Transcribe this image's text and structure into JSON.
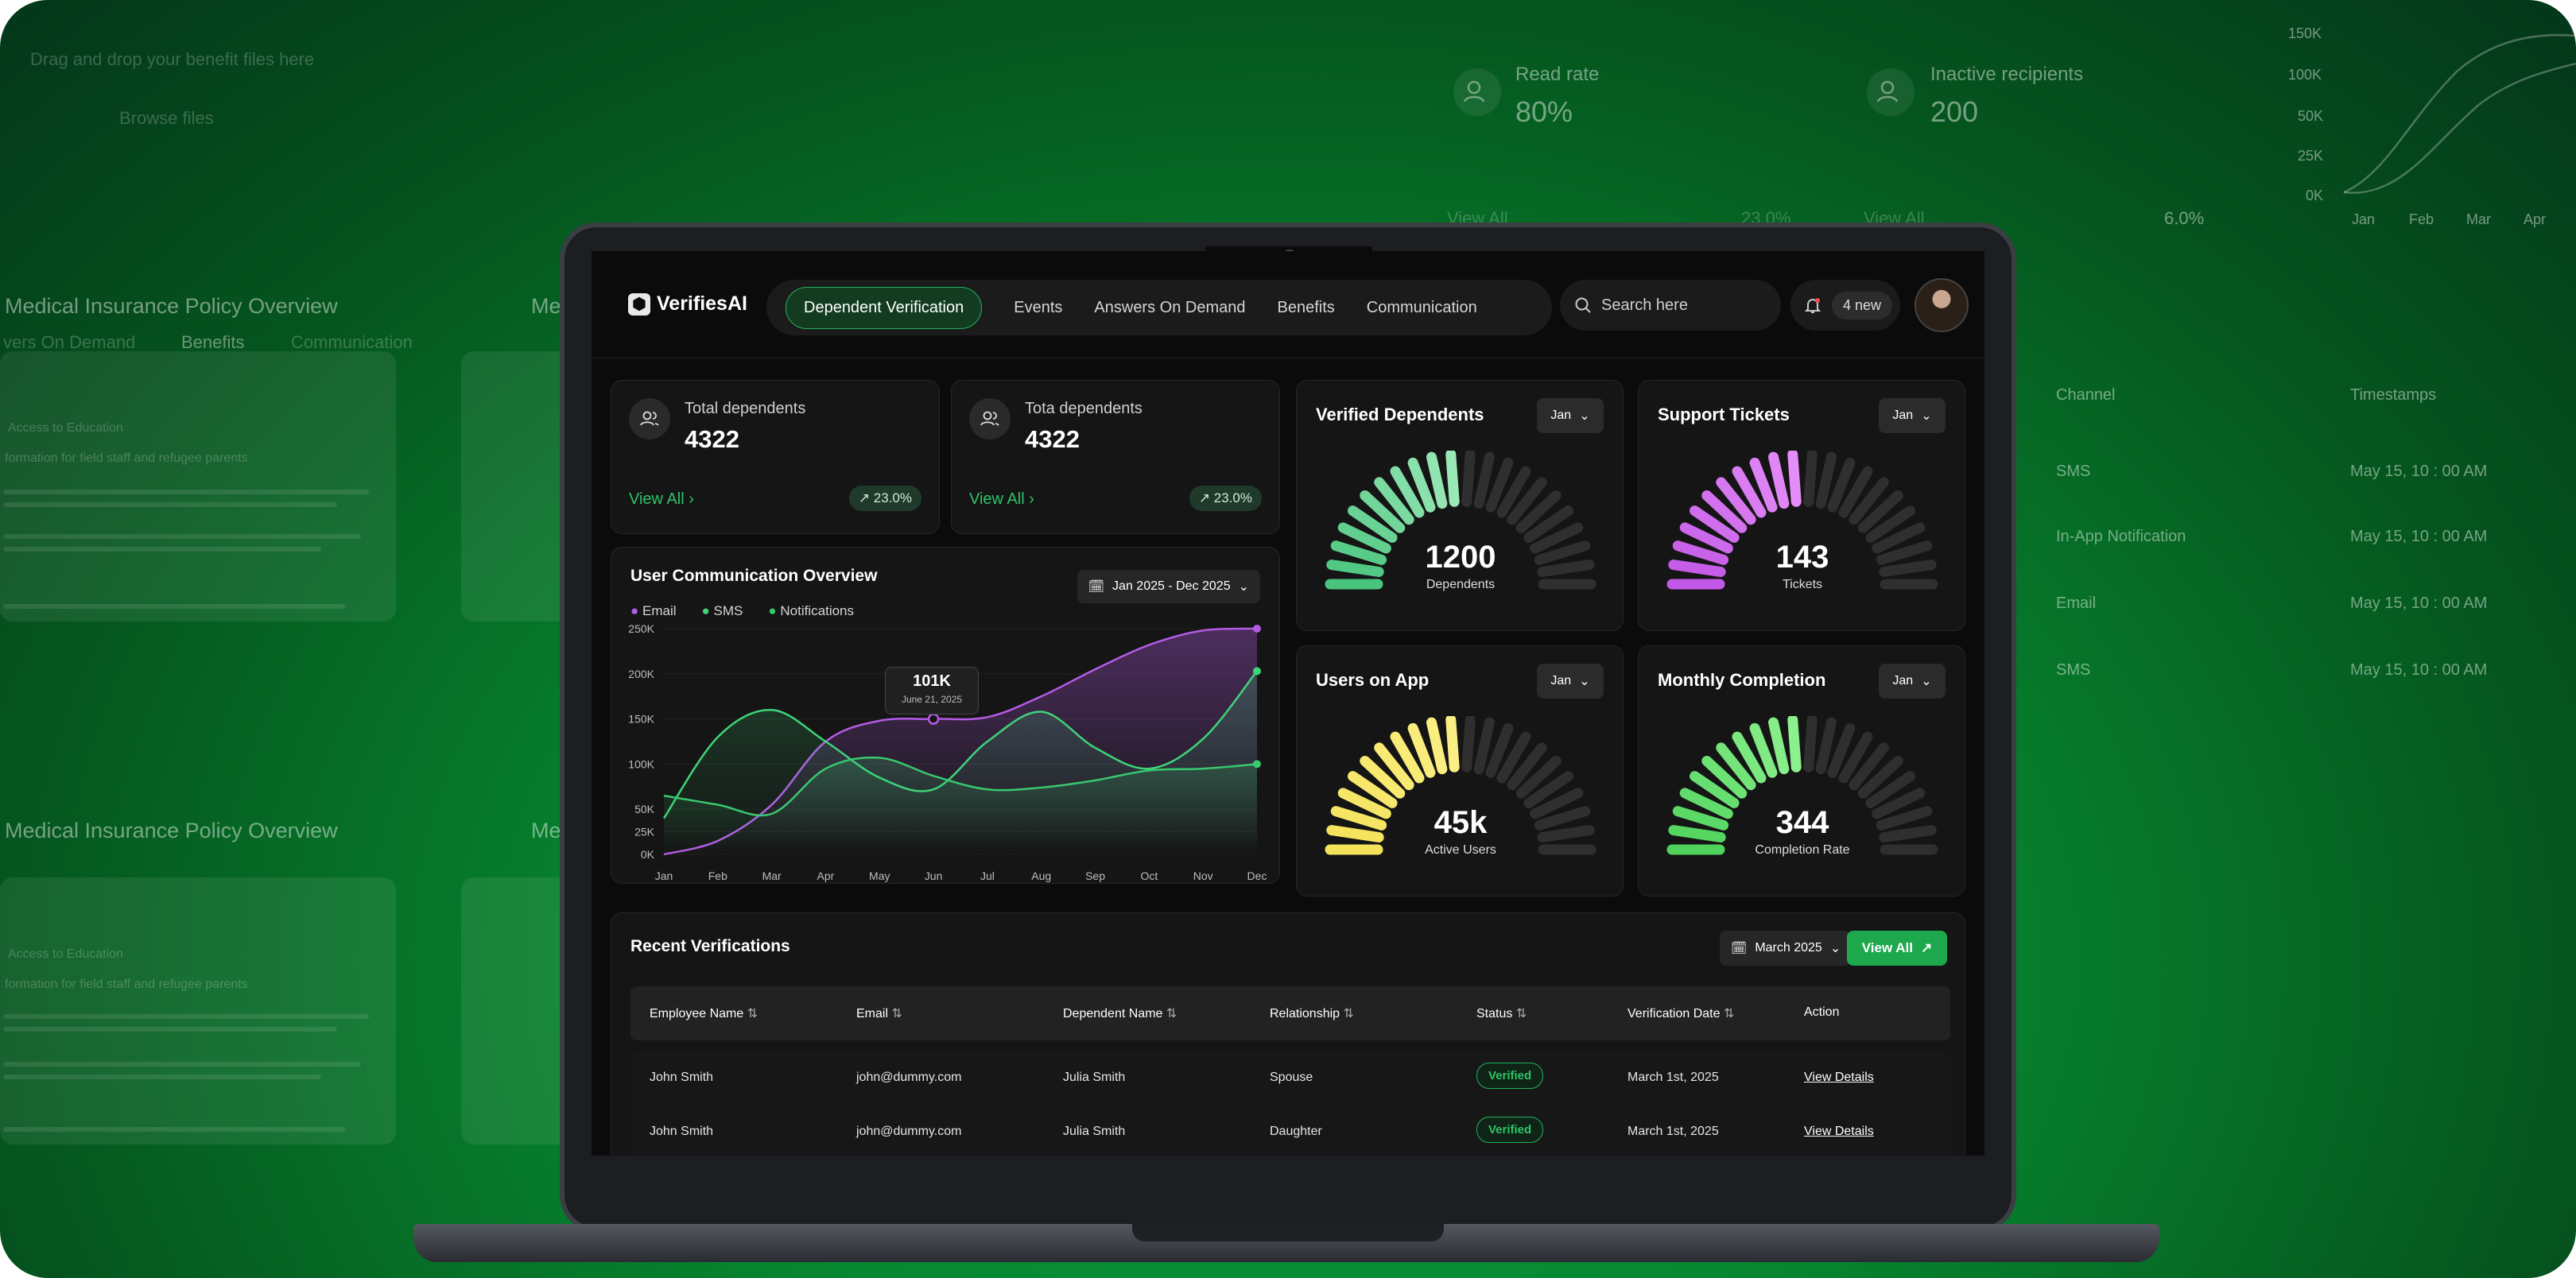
{
  "background": {
    "top_left": {
      "upload_hint": "Drag and drop your benefit files here",
      "browse": "Browse files"
    },
    "left_policies": [
      {
        "title": "Medical Insurance Policy Overview",
        "tabs": [
          "vers On Demand",
          "Benefits",
          "Communication"
        ],
        "doc_heading": "Access to Education",
        "doc_sub": "formation for field staff and refugee parents"
      },
      {
        "title": "Medical Insurance Policy Overview",
        "doc_heading": "Access to Education",
        "doc_sub": "formation for field staff and refugee parents"
      }
    ],
    "metrics": [
      {
        "label": "Read rate",
        "value": "80%"
      },
      {
        "label": "Inactive recipients",
        "value": "200"
      }
    ],
    "metrics_footer": [
      {
        "link": "View All",
        "trend": "23.0%"
      },
      {
        "link": "View All",
        "trend": "6.0%"
      }
    ],
    "mini_chart": {
      "y_ticks": [
        "150K",
        "100K",
        "50K",
        "25K",
        "0K"
      ],
      "x_ticks": [
        "Jan",
        "Feb",
        "Mar",
        "Apr"
      ]
    },
    "right_table": {
      "headers": [
        "Channel",
        "Timestamps"
      ],
      "rows": [
        [
          "SMS",
          "May 15, 10 : 00 AM"
        ],
        [
          "In-App Notification",
          "May 15, 10 : 00 AM"
        ],
        [
          "Email",
          "May 15, 10 : 00 AM"
        ],
        [
          "SMS",
          "May 15, 10 : 00 AM"
        ]
      ]
    }
  },
  "app": {
    "logo": "VerifiesAI",
    "tabs": [
      "Dependent Verification",
      "Events",
      "Answers On Demand",
      "Benefits",
      "Communication"
    ],
    "active_tab": "Dependent Verification",
    "search_placeholder": "Search here",
    "notifications": "4 new",
    "stats": [
      {
        "title": "Total dependents",
        "value": "4322",
        "link": "View All",
        "trend": "23.0%"
      },
      {
        "title": "Tota dependents",
        "value": "4322",
        "link": "View All",
        "trend": "23.0%"
      }
    ],
    "chart_panel": {
      "title": "User Communication Overview",
      "date_range": "Jan 2025 - Dec 2025",
      "tooltip_value": "101K",
      "tooltip_date": "June 21, 2025"
    },
    "gauges": [
      {
        "title": "Verified Dependents",
        "period": "Jan",
        "value": "1200",
        "label": "Dependents",
        "fill": 0.5,
        "color_start": "#49c47e",
        "color_end": "#9be8b7"
      },
      {
        "title": "Support Tickets",
        "period": "Jan",
        "value": "143",
        "label": "Tickets",
        "fill": 0.5,
        "color_start": "#c258e6",
        "color_end": "#e48cf7"
      },
      {
        "title": "Users on App",
        "period": "Jan",
        "value": "45k",
        "label": "Active Users",
        "fill": 0.5,
        "color_start": "#f4e25a",
        "color_end": "#fbef84"
      },
      {
        "title": "Monthly Completion",
        "period": "Jan",
        "value": "344",
        "label": "Completion Rate",
        "fill": 0.5,
        "color_start": "#4fd35c",
        "color_end": "#8cf08e"
      }
    ],
    "recent": {
      "title": "Recent Verifications",
      "month": "March 2025",
      "view_all": "View All",
      "headers": [
        "Employee Name",
        "Email",
        "Dependent Name",
        "Relationship",
        "Status",
        "Verification Date",
        "Action"
      ],
      "rows": [
        {
          "employee": "John Smith",
          "email": "john@dummy.com",
          "dependent": "Julia Smith",
          "relationship": "Spouse",
          "status": "Verified",
          "date": "March 1st, 2025",
          "action": "View Details"
        },
        {
          "employee": "John Smith",
          "email": "john@dummy.com",
          "dependent": "Julia Smith",
          "relationship": "Daughter",
          "status": "Verified",
          "date": "March 1st, 2025",
          "action": "View Details"
        }
      ]
    }
  },
  "chart_data": {
    "type": "area",
    "categories": [
      "Jan",
      "Feb",
      "Mar",
      "Apr",
      "May",
      "Jun",
      "Jul",
      "Aug",
      "Sep",
      "Oct",
      "Nov",
      "Dec"
    ],
    "ylim": [
      0,
      250000
    ],
    "y_ticks": [
      "250K",
      "200K",
      "150K",
      "100K",
      "50K",
      "25K",
      "0K"
    ],
    "legend": [
      "Email",
      "SMS",
      "Notifications"
    ],
    "series": [
      {
        "name": "Email",
        "color": "#b45be6",
        "values": [
          0,
          15000,
          55000,
          125000,
          148000,
          150000,
          152000,
          175000,
          205000,
          232000,
          248000,
          250000
        ]
      },
      {
        "name": "SMS",
        "color": "#3fd47a",
        "values": [
          40000,
          130000,
          160000,
          125000,
          85000,
          72000,
          125000,
          158000,
          118000,
          95000,
          128000,
          203000
        ]
      },
      {
        "name": "Notifications",
        "color": "#39c86e",
        "values": [
          65000,
          55000,
          45000,
          95000,
          107000,
          87000,
          72000,
          74000,
          82000,
          93000,
          95000,
          100000
        ]
      }
    ]
  }
}
